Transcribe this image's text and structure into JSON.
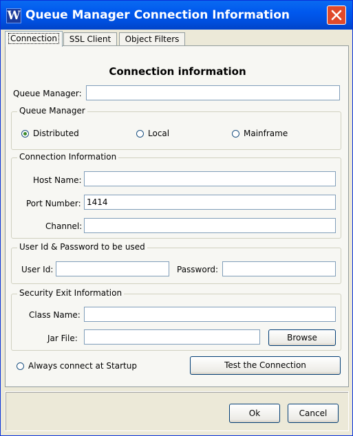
{
  "window": {
    "title": "Queue Manager Connection Information",
    "icon_letter": "W",
    "icon": "app-logo-icon",
    "close_icon": "close-icon"
  },
  "tabs": [
    {
      "label": "Connection",
      "active": true
    },
    {
      "label": "SSL Client",
      "active": false
    },
    {
      "label": "Object Filters",
      "active": false
    }
  ],
  "heading": "Connection information",
  "queue_manager_field": {
    "label": "Queue Manager:",
    "value": ""
  },
  "queue_manager_group": {
    "title": "Queue Manager",
    "options": [
      {
        "label": "Distributed",
        "selected": true
      },
      {
        "label": "Local",
        "selected": false
      },
      {
        "label": "Mainframe",
        "selected": false
      }
    ]
  },
  "connection_group": {
    "title": "Connection Information",
    "host_label": "Host Name:",
    "host_value": "",
    "port_label": "Port Number:",
    "port_value": "1414",
    "channel_label": "Channel:",
    "channel_value": ""
  },
  "user_group": {
    "title": "User Id & Password to be used",
    "userid_label": "User Id:",
    "userid_value": "",
    "password_label": "Password:",
    "password_value": ""
  },
  "security_group": {
    "title": "Security Exit Information",
    "class_label": "Class Name:",
    "class_value": "",
    "jar_label": "Jar File:",
    "jar_value": "",
    "browse_label": "Browse"
  },
  "startup": {
    "label": "Always connect at Startup",
    "selected": false
  },
  "test_button": "Test the Connection",
  "ok_button": "Ok",
  "cancel_button": "Cancel",
  "colors": {
    "titlebar": "#0058ee",
    "close": "#e04a2a",
    "dialog": "#ece9d8",
    "panel": "#f7f7f3"
  }
}
